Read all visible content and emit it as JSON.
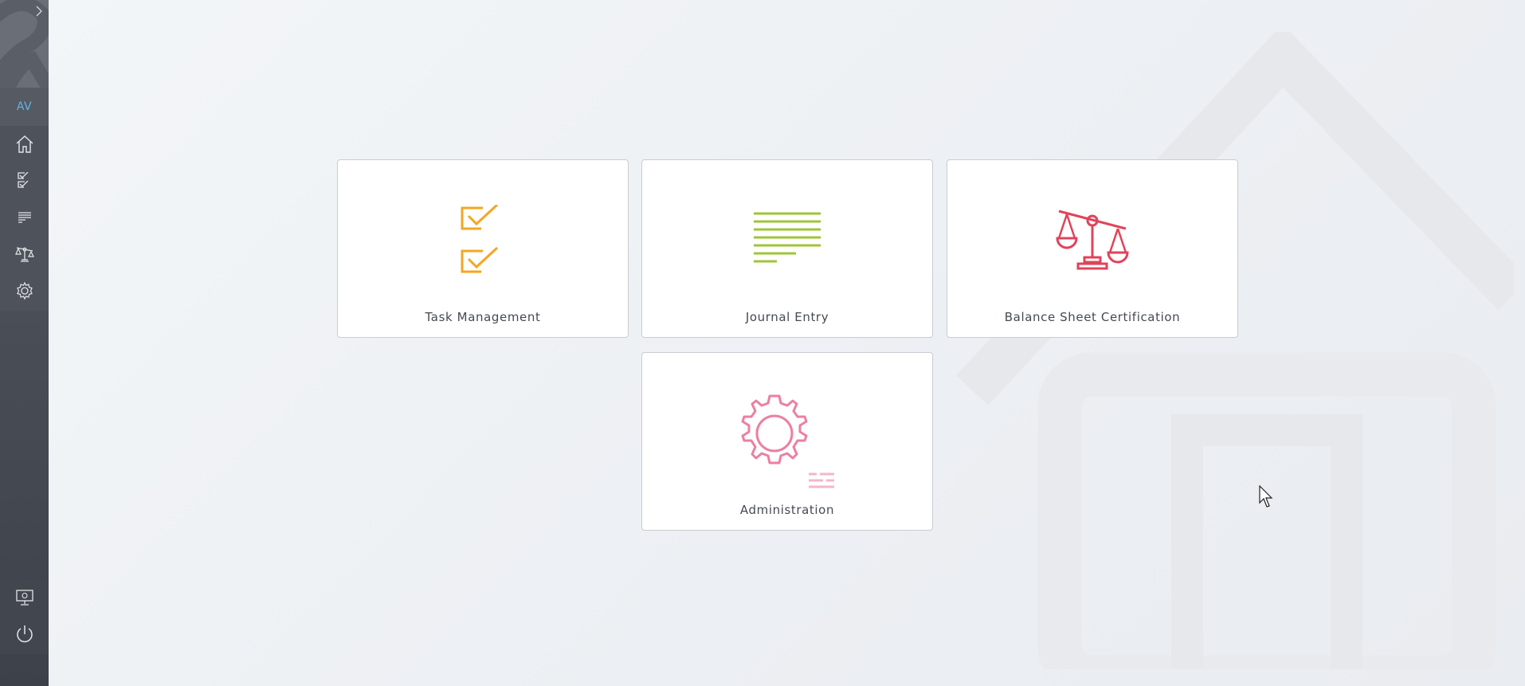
{
  "user": {
    "initials": "AV"
  },
  "sidebar": {
    "items": [
      {
        "name": "home",
        "icon": "home-icon"
      },
      {
        "name": "tasks",
        "icon": "checklist-icon"
      },
      {
        "name": "journal",
        "icon": "lines-icon"
      },
      {
        "name": "balance",
        "icon": "scale-icon"
      },
      {
        "name": "admin",
        "icon": "gear-icon"
      }
    ],
    "bottom": [
      {
        "name": "display-settings",
        "icon": "monitor-gear-icon"
      },
      {
        "name": "logout",
        "icon": "power-icon"
      }
    ]
  },
  "modules": [
    {
      "label": "Task Management",
      "icon": "checklist-icon",
      "color": "#f5a623"
    },
    {
      "label": "Journal Entry",
      "icon": "lines-icon",
      "color": "#a0c43a"
    },
    {
      "label": "Balance Sheet Certification",
      "icon": "scale-icon",
      "color": "#e0435a"
    },
    {
      "label": "Administration",
      "icon": "gear-icon",
      "color": "#ec7fa2"
    }
  ],
  "colors": {
    "accent": "#5fb6e8",
    "sidebar": "#4b4f57"
  }
}
